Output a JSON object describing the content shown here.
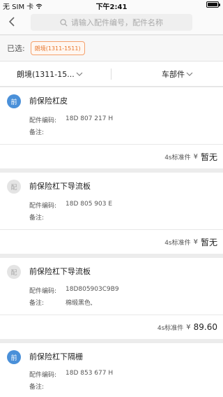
{
  "status_bar": {
    "carrier": "无 SIM 卡",
    "time": "下午2:41"
  },
  "search": {
    "placeholder": "请输入配件编号，配件名称"
  },
  "selection": {
    "label": "已选:",
    "tag": "朗境(1311-1511)"
  },
  "filters": {
    "model": "朗境(1311-15...",
    "category": "车部件"
  },
  "parts": [
    {
      "badge": "前",
      "badge_style": "blue",
      "name": "前保险杠皮",
      "code_label": "配件编码:",
      "code": "18D 807 217 H",
      "note_label": "备注:",
      "note": "",
      "standard": "4s标准件",
      "currency": "¥",
      "price": "暂无"
    },
    {
      "badge": "配",
      "badge_style": "gray",
      "name": "前保险杠下导流板",
      "code_label": "配件编码:",
      "code": "18D 805 903 E",
      "note_label": "备注:",
      "note": "",
      "standard": "4s标准件",
      "currency": "¥",
      "price": "暂无"
    },
    {
      "badge": "配",
      "badge_style": "gray",
      "name": "前保险杠下导流板",
      "code_label": "配件编码:",
      "code": "18D805903C9B9",
      "note_label": "备注:",
      "note": "棉缎黑色,",
      "standard": "4s标准件",
      "currency": "¥",
      "price": "89.60"
    },
    {
      "badge": "前",
      "badge_style": "blue",
      "name": "前保险杠下隔栅",
      "code_label": "配件编码:",
      "code": "18D 853 677 H",
      "note_label": "备注:",
      "note": ""
    }
  ]
}
